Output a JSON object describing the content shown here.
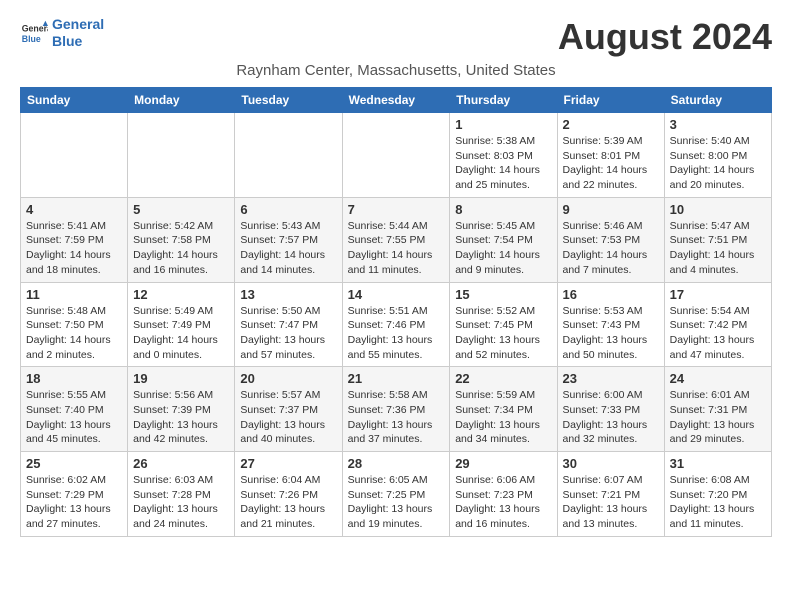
{
  "header": {
    "logo_line1": "General",
    "logo_line2": "Blue",
    "title": "August 2024",
    "subtitle": "Raynham Center, Massachusetts, United States"
  },
  "days_of_week": [
    "Sunday",
    "Monday",
    "Tuesday",
    "Wednesday",
    "Thursday",
    "Friday",
    "Saturday"
  ],
  "weeks": [
    [
      {
        "num": "",
        "info": ""
      },
      {
        "num": "",
        "info": ""
      },
      {
        "num": "",
        "info": ""
      },
      {
        "num": "",
        "info": ""
      },
      {
        "num": "1",
        "info": "Sunrise: 5:38 AM\nSunset: 8:03 PM\nDaylight: 14 hours and 25 minutes."
      },
      {
        "num": "2",
        "info": "Sunrise: 5:39 AM\nSunset: 8:01 PM\nDaylight: 14 hours and 22 minutes."
      },
      {
        "num": "3",
        "info": "Sunrise: 5:40 AM\nSunset: 8:00 PM\nDaylight: 14 hours and 20 minutes."
      }
    ],
    [
      {
        "num": "4",
        "info": "Sunrise: 5:41 AM\nSunset: 7:59 PM\nDaylight: 14 hours and 18 minutes."
      },
      {
        "num": "5",
        "info": "Sunrise: 5:42 AM\nSunset: 7:58 PM\nDaylight: 14 hours and 16 minutes."
      },
      {
        "num": "6",
        "info": "Sunrise: 5:43 AM\nSunset: 7:57 PM\nDaylight: 14 hours and 14 minutes."
      },
      {
        "num": "7",
        "info": "Sunrise: 5:44 AM\nSunset: 7:55 PM\nDaylight: 14 hours and 11 minutes."
      },
      {
        "num": "8",
        "info": "Sunrise: 5:45 AM\nSunset: 7:54 PM\nDaylight: 14 hours and 9 minutes."
      },
      {
        "num": "9",
        "info": "Sunrise: 5:46 AM\nSunset: 7:53 PM\nDaylight: 14 hours and 7 minutes."
      },
      {
        "num": "10",
        "info": "Sunrise: 5:47 AM\nSunset: 7:51 PM\nDaylight: 14 hours and 4 minutes."
      }
    ],
    [
      {
        "num": "11",
        "info": "Sunrise: 5:48 AM\nSunset: 7:50 PM\nDaylight: 14 hours and 2 minutes."
      },
      {
        "num": "12",
        "info": "Sunrise: 5:49 AM\nSunset: 7:49 PM\nDaylight: 14 hours and 0 minutes."
      },
      {
        "num": "13",
        "info": "Sunrise: 5:50 AM\nSunset: 7:47 PM\nDaylight: 13 hours and 57 minutes."
      },
      {
        "num": "14",
        "info": "Sunrise: 5:51 AM\nSunset: 7:46 PM\nDaylight: 13 hours and 55 minutes."
      },
      {
        "num": "15",
        "info": "Sunrise: 5:52 AM\nSunset: 7:45 PM\nDaylight: 13 hours and 52 minutes."
      },
      {
        "num": "16",
        "info": "Sunrise: 5:53 AM\nSunset: 7:43 PM\nDaylight: 13 hours and 50 minutes."
      },
      {
        "num": "17",
        "info": "Sunrise: 5:54 AM\nSunset: 7:42 PM\nDaylight: 13 hours and 47 minutes."
      }
    ],
    [
      {
        "num": "18",
        "info": "Sunrise: 5:55 AM\nSunset: 7:40 PM\nDaylight: 13 hours and 45 minutes."
      },
      {
        "num": "19",
        "info": "Sunrise: 5:56 AM\nSunset: 7:39 PM\nDaylight: 13 hours and 42 minutes."
      },
      {
        "num": "20",
        "info": "Sunrise: 5:57 AM\nSunset: 7:37 PM\nDaylight: 13 hours and 40 minutes."
      },
      {
        "num": "21",
        "info": "Sunrise: 5:58 AM\nSunset: 7:36 PM\nDaylight: 13 hours and 37 minutes."
      },
      {
        "num": "22",
        "info": "Sunrise: 5:59 AM\nSunset: 7:34 PM\nDaylight: 13 hours and 34 minutes."
      },
      {
        "num": "23",
        "info": "Sunrise: 6:00 AM\nSunset: 7:33 PM\nDaylight: 13 hours and 32 minutes."
      },
      {
        "num": "24",
        "info": "Sunrise: 6:01 AM\nSunset: 7:31 PM\nDaylight: 13 hours and 29 minutes."
      }
    ],
    [
      {
        "num": "25",
        "info": "Sunrise: 6:02 AM\nSunset: 7:29 PM\nDaylight: 13 hours and 27 minutes."
      },
      {
        "num": "26",
        "info": "Sunrise: 6:03 AM\nSunset: 7:28 PM\nDaylight: 13 hours and 24 minutes."
      },
      {
        "num": "27",
        "info": "Sunrise: 6:04 AM\nSunset: 7:26 PM\nDaylight: 13 hours and 21 minutes."
      },
      {
        "num": "28",
        "info": "Sunrise: 6:05 AM\nSunset: 7:25 PM\nDaylight: 13 hours and 19 minutes."
      },
      {
        "num": "29",
        "info": "Sunrise: 6:06 AM\nSunset: 7:23 PM\nDaylight: 13 hours and 16 minutes."
      },
      {
        "num": "30",
        "info": "Sunrise: 6:07 AM\nSunset: 7:21 PM\nDaylight: 13 hours and 13 minutes."
      },
      {
        "num": "31",
        "info": "Sunrise: 6:08 AM\nSunset: 7:20 PM\nDaylight: 13 hours and 11 minutes."
      }
    ]
  ]
}
